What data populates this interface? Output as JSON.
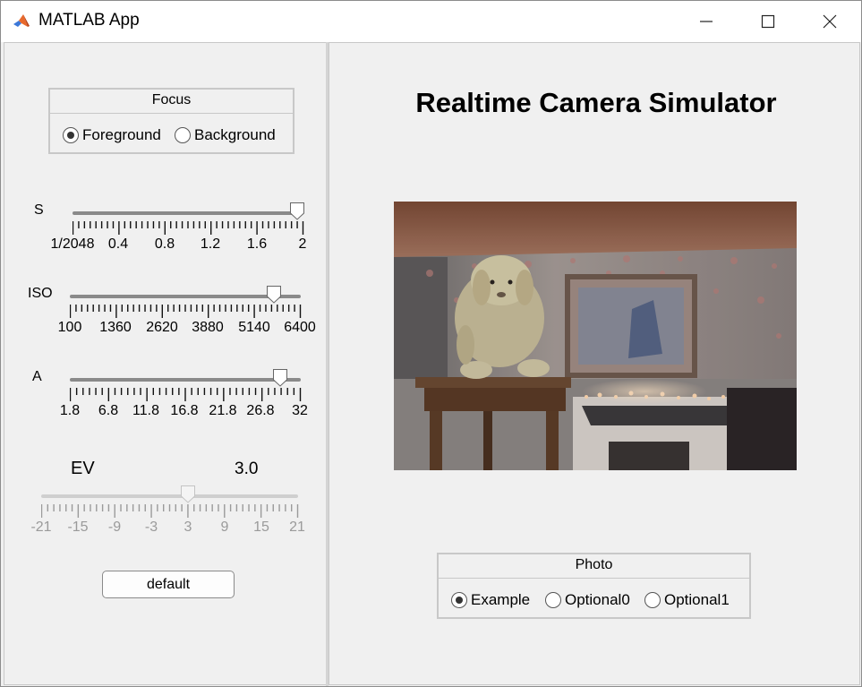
{
  "window": {
    "title": "MATLAB App",
    "icon": "matlab-icon",
    "controls": {
      "minimize": "minimize-icon",
      "maximize": "maximize-icon",
      "close": "close-icon"
    }
  },
  "focus": {
    "title": "Focus",
    "options": [
      {
        "label": "Foreground",
        "selected": true
      },
      {
        "label": "Background",
        "selected": false
      }
    ]
  },
  "sliders": {
    "s": {
      "label": "S",
      "tick_labels": [
        "1/2048",
        "0.4",
        "0.8",
        "1.2",
        "1.6",
        "2"
      ],
      "value": 1.95
    },
    "iso": {
      "label": "ISO",
      "tick_labels": [
        "100",
        "1360",
        "2620",
        "3880",
        "5140",
        "6400"
      ],
      "value": 5620
    },
    "a": {
      "label": "A",
      "tick_labels": [
        "1.8",
        "6.8",
        "11.8",
        "16.8",
        "21.8",
        "26.8",
        "32"
      ],
      "value": 29.5
    },
    "ev": {
      "label": "EV",
      "display_value": "3.0",
      "tick_labels": [
        "-21",
        "-15",
        "-9",
        "-3",
        "3",
        "9",
        "15",
        "21"
      ],
      "value": 3,
      "enabled": false
    }
  },
  "default_button": {
    "label": "default"
  },
  "main": {
    "title": "Realtime Camera Simulator"
  },
  "photo_group": {
    "title": "Photo",
    "options": [
      {
        "label": "Example",
        "selected": true
      },
      {
        "label": "Optional0",
        "selected": false
      },
      {
        "label": "Optional1",
        "selected": false
      }
    ]
  },
  "colors": {
    "window_bg": "#f0f0f0",
    "panel_border": "#c8c8c8",
    "track": "#8a8a8a"
  }
}
